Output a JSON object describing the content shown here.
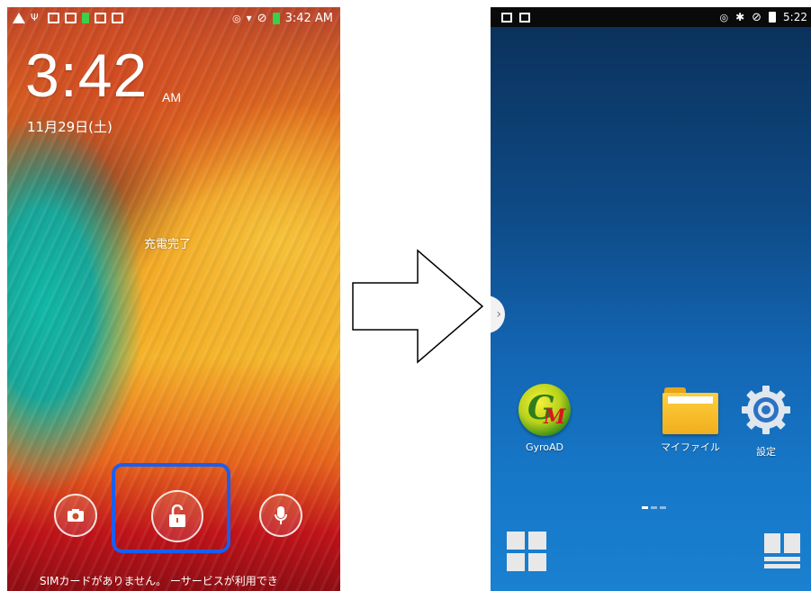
{
  "lock_screen": {
    "status_time": "3:42 AM",
    "clock_time": "3:42",
    "ampm": "AM",
    "date": "11月29日(土)",
    "charge_status": "充電完了",
    "bottom_message": "SIMカードがありません。 ーサービスが利用でき",
    "shortcuts": [
      "camera-icon",
      "unlock-icon",
      "microphone-icon"
    ]
  },
  "home_screen": {
    "status_time": "5:22",
    "apps": [
      {
        "label": "GyroAD",
        "icon": "gyroad-icon"
      },
      {
        "label": "マイファイル",
        "icon": "folder-icon"
      },
      {
        "label": "設定",
        "icon": "gear-icon"
      }
    ],
    "page_indicator": {
      "pages": 3,
      "current": 1
    }
  },
  "colors": {
    "highlight": "#1a5ef0",
    "home_bg": "#1366b4"
  }
}
